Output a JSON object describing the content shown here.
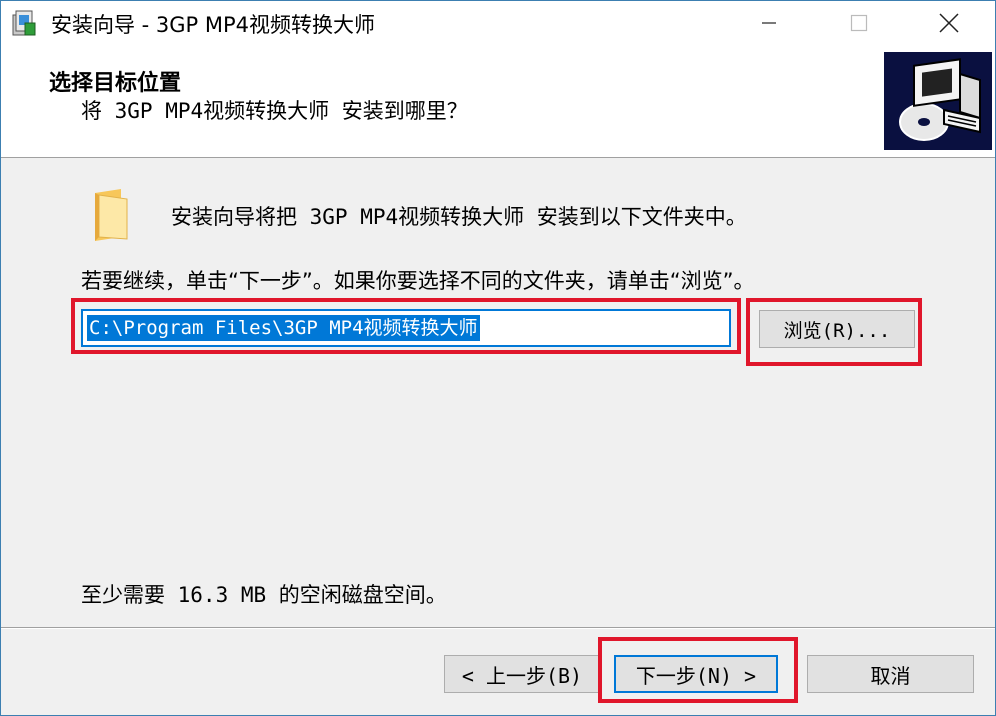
{
  "window": {
    "title": "安装向导 - 3GP MP4视频转换大师"
  },
  "header": {
    "title": "选择目标位置",
    "subtitle": "将 3GP MP4视频转换大师 安装到哪里？"
  },
  "body": {
    "intro": "安装向导将把 3GP MP4视频转换大师 安装到以下文件夹中。",
    "instruction": "若要继续，单击“下一步”。如果你要选择不同的文件夹，请单击“浏览”。",
    "path_value": "C:\\Program Files\\3GP MP4视频转换大师",
    "browse_label": "浏览(R)...",
    "space_required": "至少需要 16.3 MB 的空闲磁盘空间。"
  },
  "footer": {
    "back_label": "< 上一步(B)",
    "next_label": "下一步(N) >",
    "cancel_label": "取消"
  },
  "colors": {
    "accent": "#0078d7",
    "highlight": "#e0162b"
  },
  "icons": {
    "app": "installer-icon",
    "folder": "folder-icon",
    "header_image": "computer-install-icon"
  }
}
